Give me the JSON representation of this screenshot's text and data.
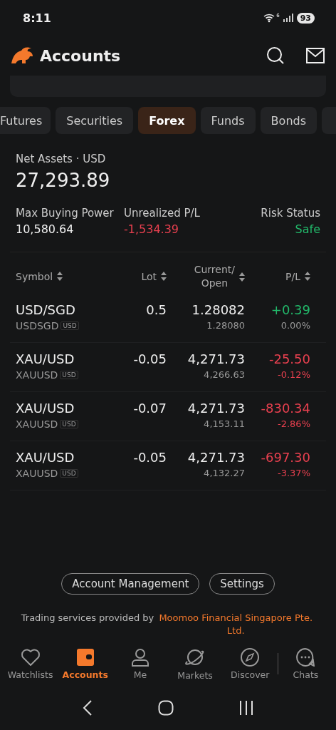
{
  "status_bar": {
    "time": "8:11",
    "wifi_label": "6",
    "battery": "93"
  },
  "header": {
    "title": "Accounts"
  },
  "tabs": [
    {
      "label": "Futures",
      "selected": false
    },
    {
      "label": "Securities",
      "selected": false
    },
    {
      "label": "Forex",
      "selected": true
    },
    {
      "label": "Funds",
      "selected": false
    },
    {
      "label": "Bonds",
      "selected": false
    }
  ],
  "summary": {
    "net_assets_label": "Net Assets · USD",
    "net_assets": "27,293.89",
    "stats": [
      {
        "label": "Max Buying Power",
        "value": "10,580.64",
        "color": "#eeeeee"
      },
      {
        "label": "Unrealized P/L",
        "value": "-1,534.39",
        "color": "#e8404f"
      },
      {
        "label": "Risk Status",
        "value": "Safe",
        "color": "#22b86a"
      }
    ]
  },
  "table": {
    "columns": [
      "Symbol",
      "Lot",
      "Current/ Open",
      "P/L"
    ],
    "rows": [
      {
        "symbol": "USD/SGD",
        "code": "USDSGD",
        "currency": "USD",
        "lot": "0.5",
        "current": "1.28082",
        "open": "1.28080",
        "pl": {
          "text": "+0.39",
          "color": "#22b86a"
        },
        "pct": {
          "text": "0.00%",
          "color": "#999999"
        }
      },
      {
        "symbol": "XAU/USD",
        "code": "XAUUSD",
        "currency": "USD",
        "lot": "-0.05",
        "current": "4,271.73",
        "open": "4,266.63",
        "pl": {
          "text": "-25.50",
          "color": "#e8404f"
        },
        "pct": {
          "text": "-0.12%",
          "color": "#e8404f"
        }
      },
      {
        "symbol": "XAU/USD",
        "code": "XAUUSD",
        "currency": "USD",
        "lot": "-0.07",
        "current": "4,271.73",
        "open": "4,153.11",
        "pl": {
          "text": "-830.34",
          "color": "#e8404f"
        },
        "pct": {
          "text": "-2.86%",
          "color": "#e8404f"
        }
      },
      {
        "symbol": "XAU/USD",
        "code": "XAUUSD",
        "currency": "USD",
        "lot": "-0.05",
        "current": "4,271.73",
        "open": "4,132.27",
        "pl": {
          "text": "-697.30",
          "color": "#e8404f"
        },
        "pct": {
          "text": "-3.37%",
          "color": "#e8404f"
        }
      }
    ]
  },
  "buttons": [
    "Account Management",
    "Settings"
  ],
  "footer": {
    "text": "Trading services provided by",
    "link": "Moomoo Financial Singapore Pte. Ltd."
  },
  "nav": [
    {
      "label": "Watchlists",
      "kind": "heart",
      "selected": false
    },
    {
      "label": "Accounts",
      "kind": "wallet",
      "selected": true
    },
    {
      "label": "Me",
      "kind": "person",
      "selected": false
    },
    {
      "label": "Markets",
      "kind": "planet",
      "selected": false
    },
    {
      "label": "Discover",
      "kind": "compass",
      "selected": false
    },
    {
      "label": "Chats",
      "kind": "chat",
      "selected": false
    }
  ]
}
